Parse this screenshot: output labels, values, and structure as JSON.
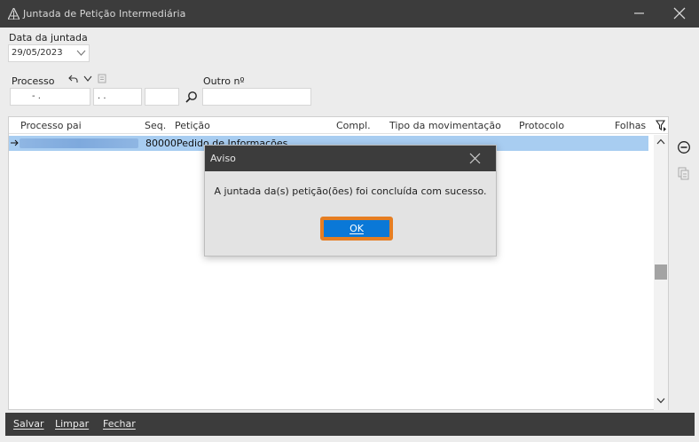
{
  "window": {
    "title": "Juntada de Petição Intermediária"
  },
  "form": {
    "date_label": "Data da juntada",
    "date_value": "29/05/2023",
    "processo_label": "Processo",
    "processo_part1": "-  .",
    "processo_part2": ". .",
    "outro_label": "Outro nº"
  },
  "grid": {
    "columns": [
      "Processo pai",
      "Seq.",
      "Petição",
      "Compl.",
      "Tipo da movimentação",
      "Protocolo",
      "Folhas"
    ],
    "rows": [
      {
        "seq": "80000",
        "peticao": "Pedido de Informações"
      }
    ]
  },
  "dialog": {
    "title": "Aviso",
    "message": "A juntada da(s) petição(ões) foi concluída com sucesso.",
    "ok_label": "OK"
  },
  "bottom": {
    "save": "Salvar",
    "clear": "Limpar",
    "close": "Fechar"
  },
  "colors": {
    "titlebar": "#3c3c3c",
    "selection": "#a8cdf1",
    "ok_button": "#0a78d7",
    "focus_border": "#e67e22"
  }
}
